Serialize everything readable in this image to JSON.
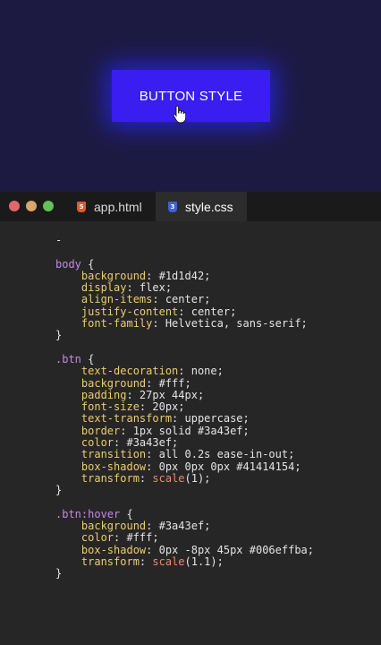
{
  "preview": {
    "button_label": "BUTTON STYLE"
  },
  "window": {
    "controls": [
      "close",
      "minimize",
      "maximize"
    ]
  },
  "tabs": [
    {
      "label": "app.html",
      "icon": "html5-icon",
      "active": false
    },
    {
      "label": "style.css",
      "icon": "css3-icon",
      "active": true
    }
  ],
  "editor": {
    "lines": [
      {
        "tokens": [
          {
            "t": "-",
            "c": "punc"
          }
        ]
      },
      {
        "tokens": []
      },
      {
        "tokens": [
          {
            "t": "body",
            "c": "sel"
          },
          {
            "t": " {",
            "c": "punc"
          }
        ]
      },
      {
        "tokens": [
          {
            "t": "    background",
            "c": "prop"
          },
          {
            "t": ": #1d1d42;",
            "c": "val"
          }
        ]
      },
      {
        "tokens": [
          {
            "t": "    display",
            "c": "prop"
          },
          {
            "t": ": flex;",
            "c": "val"
          }
        ]
      },
      {
        "tokens": [
          {
            "t": "    align-items",
            "c": "prop"
          },
          {
            "t": ": center;",
            "c": "val"
          }
        ]
      },
      {
        "tokens": [
          {
            "t": "    justify-content",
            "c": "prop"
          },
          {
            "t": ": center;",
            "c": "val"
          }
        ]
      },
      {
        "tokens": [
          {
            "t": "    font-family",
            "c": "prop"
          },
          {
            "t": ": Helvetica, sans-serif;",
            "c": "val"
          }
        ]
      },
      {
        "tokens": [
          {
            "t": "}",
            "c": "punc"
          }
        ]
      },
      {
        "tokens": []
      },
      {
        "tokens": [
          {
            "t": ".btn",
            "c": "sel"
          },
          {
            "t": " {",
            "c": "punc"
          }
        ]
      },
      {
        "tokens": [
          {
            "t": "    text-decoration",
            "c": "prop"
          },
          {
            "t": ": none;",
            "c": "val"
          }
        ]
      },
      {
        "tokens": [
          {
            "t": "    background",
            "c": "prop"
          },
          {
            "t": ": #fff;",
            "c": "val"
          }
        ]
      },
      {
        "tokens": [
          {
            "t": "    padding",
            "c": "prop"
          },
          {
            "t": ": 27px 44px;",
            "c": "val"
          }
        ]
      },
      {
        "tokens": [
          {
            "t": "    font-size",
            "c": "prop"
          },
          {
            "t": ": 20px;",
            "c": "val"
          }
        ]
      },
      {
        "tokens": [
          {
            "t": "    text-transform",
            "c": "prop"
          },
          {
            "t": ": uppercase;",
            "c": "val"
          }
        ]
      },
      {
        "tokens": [
          {
            "t": "    border",
            "c": "prop"
          },
          {
            "t": ": 1px solid #3a43ef;",
            "c": "val"
          }
        ]
      },
      {
        "tokens": [
          {
            "t": "    color",
            "c": "prop"
          },
          {
            "t": ": #3a43ef;",
            "c": "val"
          }
        ]
      },
      {
        "tokens": [
          {
            "t": "    transition",
            "c": "prop"
          },
          {
            "t": ": all 0.2s ease-in-out;",
            "c": "val"
          }
        ]
      },
      {
        "tokens": [
          {
            "t": "    box-shadow",
            "c": "prop"
          },
          {
            "t": ": 0px 0px 0px #41414154;",
            "c": "val"
          }
        ]
      },
      {
        "tokens": [
          {
            "t": "    transform",
            "c": "prop"
          },
          {
            "t": ": ",
            "c": "val"
          },
          {
            "t": "scale",
            "c": "fn"
          },
          {
            "t": "(1);",
            "c": "val"
          }
        ]
      },
      {
        "tokens": [
          {
            "t": "}",
            "c": "punc"
          }
        ]
      },
      {
        "tokens": []
      },
      {
        "tokens": [
          {
            "t": ".btn:hover",
            "c": "sel"
          },
          {
            "t": " {",
            "c": "punc"
          }
        ]
      },
      {
        "tokens": [
          {
            "t": "    background",
            "c": "prop"
          },
          {
            "t": ": #3a43ef;",
            "c": "val"
          }
        ]
      },
      {
        "tokens": [
          {
            "t": "    color",
            "c": "prop"
          },
          {
            "t": ": #fff;",
            "c": "val"
          }
        ]
      },
      {
        "tokens": [
          {
            "t": "    box-shadow",
            "c": "prop"
          },
          {
            "t": ": 0px -8px 45px #006effba;",
            "c": "val"
          }
        ]
      },
      {
        "tokens": [
          {
            "t": "    transform",
            "c": "prop"
          },
          {
            "t": ": ",
            "c": "val"
          },
          {
            "t": "scale",
            "c": "fn"
          },
          {
            "t": "(1.1);",
            "c": "val"
          }
        ]
      },
      {
        "tokens": [
          {
            "t": "}",
            "c": "punc"
          }
        ]
      }
    ]
  },
  "colors": {
    "preview_bg": "#1d1a42",
    "button_bg": "#3a1df0",
    "editor_bg": "#262626",
    "tabbar_bg": "#1a1a1a",
    "selector": "#c587e8",
    "property": "#eccc70",
    "function": "#ee8a6a"
  }
}
